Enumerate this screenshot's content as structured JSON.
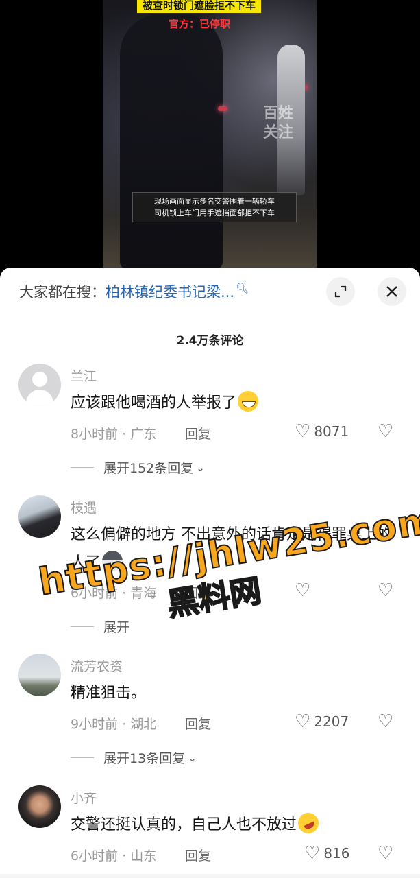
{
  "video": {
    "headline_top": "被查时锁门遮脸拒不下车",
    "headline_official": "官方：已停职",
    "watermark": "百姓关注",
    "subtitle_line1": "现场画面显示多名交警围着一辆轿车",
    "subtitle_line2": "司机锁上车门用手遮挡面部拒不下车"
  },
  "sheet": {
    "search_prefix": "大家都在搜：",
    "search_query": "柏林镇纪委书记梁...",
    "search_icon": "search-icon",
    "expand_icon": "expand-icon",
    "close_icon": "close-icon",
    "comment_count": "2.4万条评论"
  },
  "comments": [
    {
      "user": "兰江",
      "text": "应该跟他喝酒的人举报了",
      "emoji": "grin-emoji",
      "time_loc": "8小时前 · 广东",
      "reply": "回复",
      "likes": "8071",
      "more_replies": "展开152条回复"
    },
    {
      "user": "枝遇",
      "text": "这么偏僻的地方 不出意外的话肯定是得罪桌上的人了",
      "emoji": "husky-emoji",
      "time_loc": "6小时前 · 青海",
      "reply": "回复",
      "likes": "",
      "more_replies": "展开"
    },
    {
      "user": "流芳农资",
      "text": "精准狙击。",
      "time_loc": "9小时前 · 湖北",
      "reply": "回复",
      "likes": "2207",
      "more_replies": "展开13条回复"
    },
    {
      "user": "小齐",
      "text": "交警还挺认真的，自己人也不放过",
      "emoji": "rofl-emoji",
      "time_loc": "6小时前 · 山东",
      "reply": "回复",
      "likes": "816"
    }
  ],
  "overlay": {
    "url": "https://jhlw25.com",
    "name": "黑料网"
  }
}
